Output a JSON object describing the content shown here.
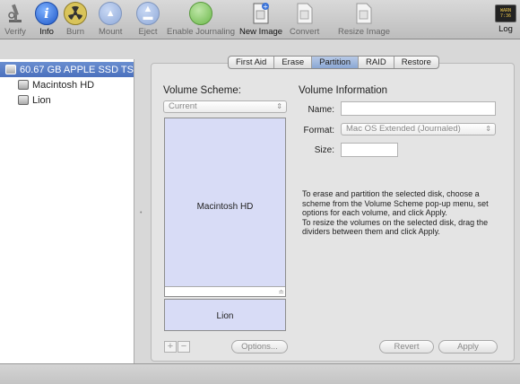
{
  "toolbar": {
    "verify": "Verify",
    "info": "Info",
    "burn": "Burn",
    "mount": "Mount",
    "eject": "Eject",
    "enable_journaling": "Enable Journaling",
    "new_image": "New Image",
    "convert": "Convert",
    "resize_image": "Resize Image",
    "log": "Log"
  },
  "sidebar": {
    "items": [
      {
        "label": "60.67 GB APPLE SSD TS0..."
      },
      {
        "label": "Macintosh HD"
      },
      {
        "label": "Lion"
      }
    ]
  },
  "tabs": [
    "First Aid",
    "Erase",
    "Partition",
    "RAID",
    "Restore"
  ],
  "partition": {
    "scheme_title": "Volume Scheme:",
    "scheme_select": "Current",
    "volumes": [
      {
        "label": "Macintosh HD"
      },
      {
        "label": "Lion"
      }
    ],
    "options_button": "Options...",
    "add": "+",
    "remove": "−"
  },
  "volume_info": {
    "title": "Volume Information",
    "name_label": "Name:",
    "name_value": "",
    "format_label": "Format:",
    "format_value": "Mac OS Extended (Journaled)",
    "size_label": "Size:",
    "size_value": "",
    "description": "To erase and partition the selected disk, choose a scheme from the Volume Scheme pop-up menu, set options for each volume, and click Apply.\nTo resize the volumes on the selected disk, drag the dividers between them and click Apply.",
    "revert_button": "Revert",
    "apply_button": "Apply"
  },
  "colors": {
    "selection": "#5179c5",
    "volume_fill": "#d8dcf6",
    "toolbar_bg": "#c9c9c9"
  }
}
